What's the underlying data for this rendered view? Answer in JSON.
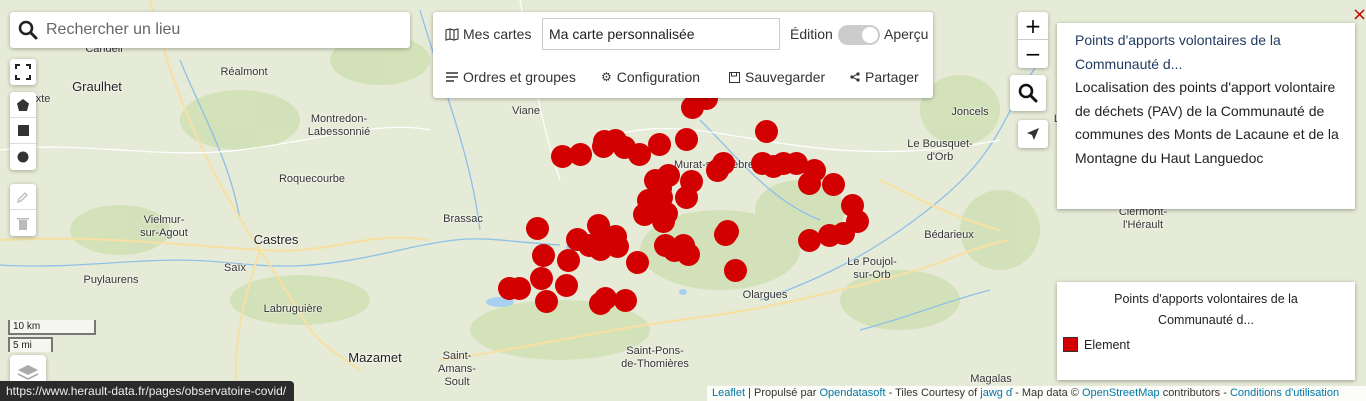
{
  "search": {
    "placeholder": "Rechercher un lieu"
  },
  "panel": {
    "my_maps": "Mes cartes",
    "map_name": "Ma carte personnalisée",
    "edition": "Édition",
    "preview": "Aperçu",
    "actions": [
      "Ordres et groupes",
      "Configuration",
      "Sauvegarder",
      "Partager"
    ]
  },
  "info": {
    "title": "Points d'apports volontaires de la Communauté d...",
    "description": "Localisation des points d'apport volontaire de déchets (PAV) de la Communauté de communes des Monts de Lacaune et de la Montagne du Haut Languedoc"
  },
  "legend": {
    "title": "Points d'apports volontaires de la Communauté d...",
    "item": "Element",
    "color": "#d20000"
  },
  "scale": {
    "km": "10 km",
    "mi": "5 mi"
  },
  "status_url": "https://www.herault-data.fr/pages/observatoire-covid/",
  "attribution": {
    "leaflet": "Leaflet",
    "propulse": "| Propulsé par",
    "ods": "Opendatasoft",
    "tiles": "- Tiles Courtesy of",
    "jawg": "jawg",
    "mapdata": "- Map data ©",
    "osm": "OpenStreetMap",
    "contrib": "contributors -",
    "cgu": "Conditions d'utilisation"
  },
  "places": [
    {
      "name": "Candeil"
    },
    {
      "name": "Réalmont"
    },
    {
      "name": "Graulhet",
      "big": true
    },
    {
      "name": "exte"
    },
    {
      "name": "Montredon-\nLabessonnié"
    },
    {
      "name": "Roquecourbe"
    },
    {
      "name": "Vielmur-\nsur-Agout"
    },
    {
      "name": "Castres",
      "big": true
    },
    {
      "name": "Saïx"
    },
    {
      "name": "Puylaurens"
    },
    {
      "name": "Labruguière"
    },
    {
      "name": "Mazamet",
      "big": true
    },
    {
      "name": "Saint-\nAmans-\nSoult"
    },
    {
      "name": "Saint-Pons-\nde-Thomières"
    },
    {
      "name": "Olargues"
    },
    {
      "name": "Brassac"
    },
    {
      "name": "Viane"
    },
    {
      "name": "Joncels"
    },
    {
      "name": "Le Bousquet-\nd'Orb"
    },
    {
      "name": "Bédarieux"
    },
    {
      "name": "Le Poujol-\nsur-Orb"
    },
    {
      "name": "Clermont-\nl'Hérault"
    },
    {
      "name": "Magalas"
    },
    {
      "name": "Lo"
    },
    {
      "name": "Murat-sur-Vèbre"
    }
  ]
}
